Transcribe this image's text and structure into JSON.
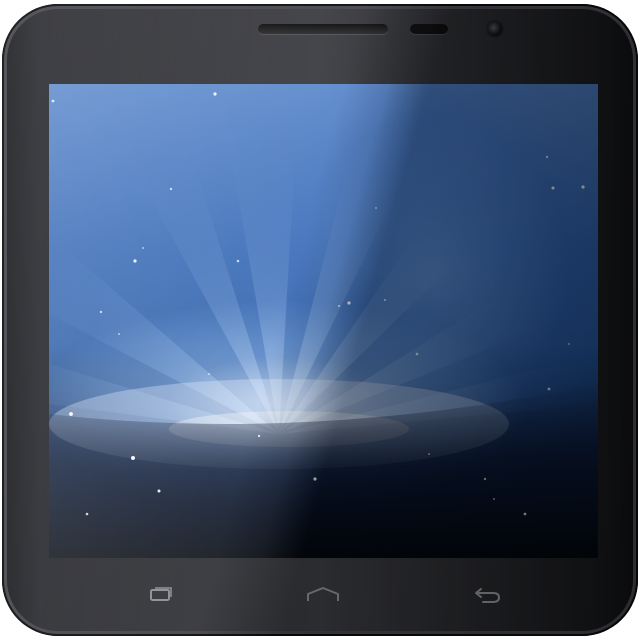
{
  "device": {
    "type": "smartphone",
    "orientation": "portrait"
  },
  "colors": {
    "bezel": "#2b2c31",
    "wallpaper_top": "#4f80c7",
    "wallpaper_bottom": "#050d1e",
    "softkey_icon": "#8b8d93"
  },
  "icons": {
    "earpiece": "earpiece-speaker",
    "sensor": "proximity-sensor",
    "camera": "front-camera",
    "softkeys": [
      "recent-apps-icon",
      "home-icon",
      "back-icon"
    ]
  }
}
